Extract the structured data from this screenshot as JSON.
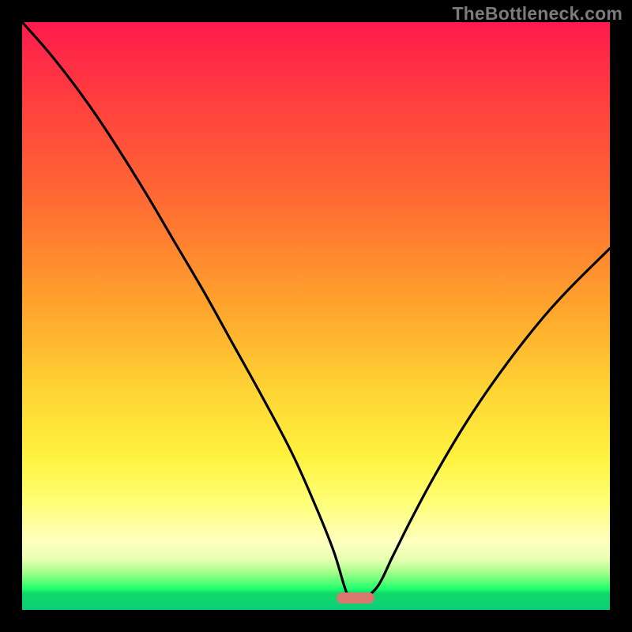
{
  "watermark": "TheBottleneck.com",
  "colors": {
    "frame_bg": "#000000",
    "curve_stroke": "#000000",
    "marker_fill": "#d9786e",
    "gradient_top": "#ff1a4d",
    "gradient_bottom": "#0ccf79"
  },
  "chart_data": {
    "type": "line",
    "title": "",
    "xlabel": "",
    "ylabel": "",
    "xlim": [
      0,
      100
    ],
    "ylim": [
      0,
      100
    ],
    "grid": false,
    "annotations": [
      "TheBottleneck.com"
    ],
    "note": "No axis tick labels are shown in the image; x and y are normalized 0–100. y≈0 (green) indicates optimal / no bottleneck; high y (red) indicates severe bottleneck. The marker shows the recommended region near x≈56.",
    "series": [
      {
        "name": "bottleneck-curve",
        "x": [
          0.0,
          4.0,
          8.0,
          12.0,
          16.0,
          21.0,
          26.0,
          31.0,
          36.0,
          41.0,
          46.0,
          50.0,
          53.0,
          55.0,
          56.0,
          58.0,
          60.5,
          63.0,
          66.0,
          70.0,
          75.0,
          80.0,
          86.0,
          92.0,
          100.0
        ],
        "y": [
          100.0,
          95.5,
          90.5,
          85.0,
          79.0,
          71.0,
          62.5,
          54.0,
          45.0,
          36.0,
          26.5,
          17.5,
          10.0,
          3.5,
          2.0,
          2.0,
          4.0,
          9.0,
          15.0,
          22.5,
          31.0,
          38.5,
          46.5,
          53.5,
          61.5
        ]
      }
    ],
    "marker": {
      "x_start": 53.5,
      "x_end": 60.0,
      "y": 2.0
    }
  }
}
